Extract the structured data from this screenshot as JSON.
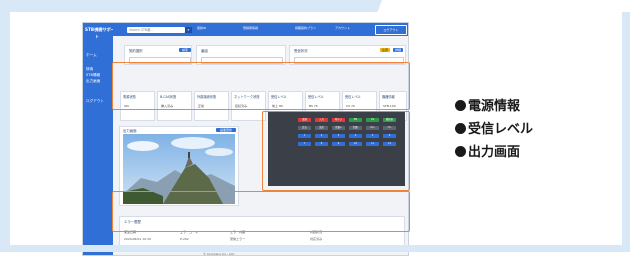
{
  "app": {
    "brand": "STB視聴サポー",
    "brand_suffix": "ト",
    "search_placeholder": "Search STB番...",
    "top_info": [
      "契約ID",
      "登録者情報",
      "視聴契約プラン",
      "アカウント"
    ],
    "user_button": "ログアウト"
  },
  "sidebar": {
    "items": [
      {
        "label": "ホーム"
      },
      {
        "label": "検索"
      },
      {
        "label": "STB情報"
      },
      {
        "label": "出力画面"
      },
      {
        "label": "ログアウト"
      }
    ]
  },
  "header_panels": {
    "selector_title": "契約選択",
    "selector_button": "検索",
    "center_title": "番組",
    "right_title": "受信状況",
    "right_chip_a": "注意",
    "right_chip_b": "詳細"
  },
  "tiles": [
    {
      "title": "電源状態",
      "value": "ON"
    },
    {
      "title": "B-CAS状態",
      "value": "挿入済み"
    },
    {
      "title": "外部接続状態",
      "value": "正常"
    },
    {
      "title": "ネットワーク状態",
      "value": "接続済み"
    },
    {
      "title": "受信レベル",
      "value": "地上 80"
    },
    {
      "title": "受信レベル",
      "value": "BS 75"
    },
    {
      "title": "受信レベル",
      "value": "CS 70"
    },
    {
      "title": "機器情報",
      "value": "STB-100"
    }
  ],
  "video_panel": {
    "title": "出力画面",
    "button": "画面更新"
  },
  "remote": {
    "buttons": [
      "電源",
      "入力",
      "地デジ",
      "BS",
      "CS",
      "番組表",
      "戻る",
      "決定",
      "音量+",
      "音量-",
      "ch+",
      "ch-",
      "1",
      "2",
      "3",
      "4",
      "5",
      "6",
      "7",
      "8",
      "9",
      "10",
      "11",
      "12"
    ]
  },
  "error_panel": {
    "title": "エラー履歴",
    "headers": [
      "発生日時",
      "エラーコード",
      "エラー内容",
      "対応状況"
    ],
    "row": [
      "2024/06/01 10:30",
      "E-202",
      "受信エラー",
      "対応済み"
    ]
  },
  "footer": {
    "copyright": "© Company Co., Ltd."
  },
  "bullets": [
    {
      "label": "電源情報"
    },
    {
      "label": "受信レベル"
    },
    {
      "label": "出力画面"
    }
  ],
  "colors": {
    "accent": "#2f6fd6",
    "highlight": "#f0843b",
    "background": "#d8e8f6"
  }
}
